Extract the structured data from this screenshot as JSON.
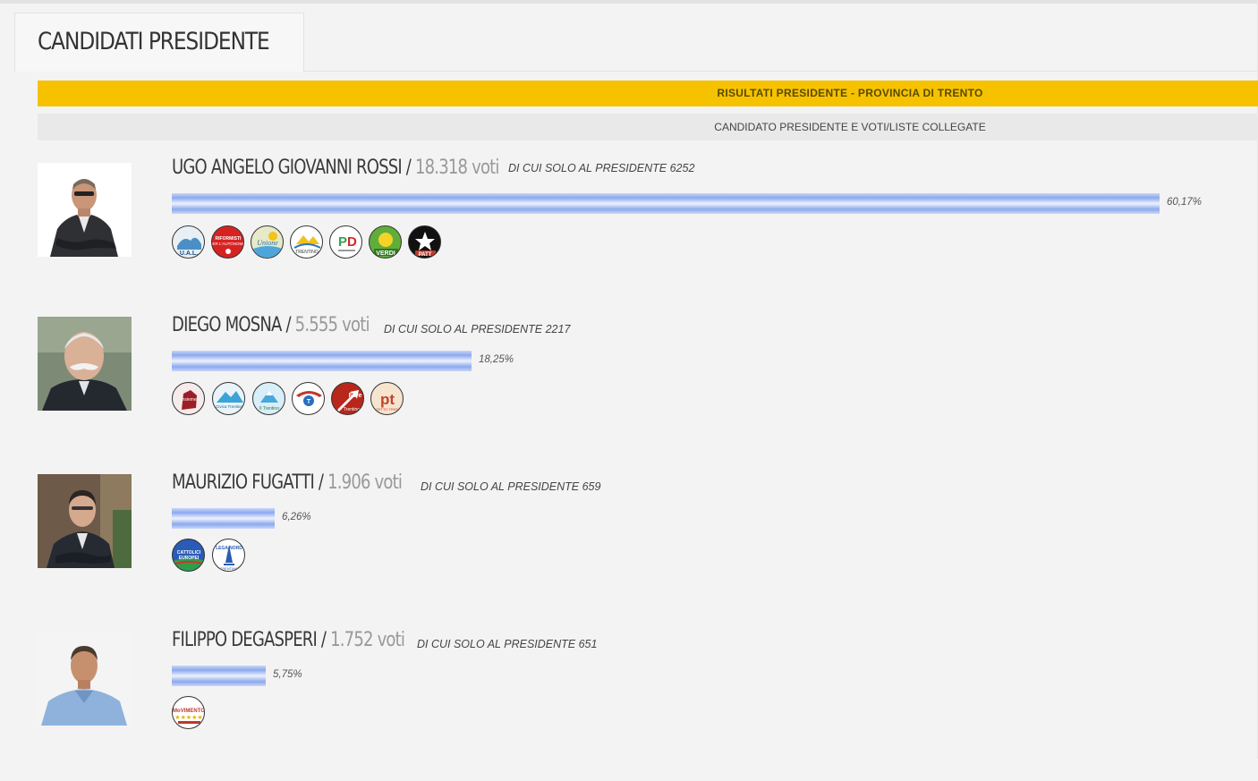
{
  "page": {
    "title": "CANDIDATI PRESIDENTE"
  },
  "results": {
    "header": "RISULTATI PRESIDENTE - PROVINCIA DI TRENTO",
    "subheader": "CANDIDATO PRESIDENTE E VOTI/LISTE COLLEGATE"
  },
  "candidates": [
    {
      "name": "UGO ANGELO GIOVANNI ROSSI",
      "separator": " / ",
      "votes": "18.318 voti",
      "solo": "DI CUI SOLO AL PRESIDENTE 6252",
      "percent": "60,17%",
      "share": 0.6017,
      "photo_icon": "candidate-photo-man-suit",
      "lists": [
        "UAL",
        "RIFORMISTI PER L'AUTONOMIA",
        "UNIONE DELL'ADIGE",
        "INTEGRALITÀ TRENTINO",
        "PD",
        "VERDI",
        "PATT"
      ]
    },
    {
      "name": "DIEGO MOSNA",
      "separator": " / ",
      "votes": "5.555 voti",
      "solo": "DI CUI SOLO AL PRESIDENTE 2217",
      "percent": "18,25%",
      "share": 0.1825,
      "photo_icon": "candidate-photo-man-mustache",
      "lists": [
        "Insieme per l'Autonomia",
        "Civica Trentina",
        "Il Trentino",
        "Amministrare il Trentino",
        "Fare Trentino",
        "Progetto Trentino"
      ]
    },
    {
      "name": "MAURIZIO FUGATTI",
      "separator": " / ",
      "votes": "1.906 voti",
      "solo": "DI CUI SOLO AL PRESIDENTE 659",
      "percent": "6,26%",
      "share": 0.0626,
      "photo_icon": "candidate-photo-man-dark-hair",
      "lists": [
        "Cattolici Europei Uniti",
        "Lega Nord Trentino"
      ]
    },
    {
      "name": "FILIPPO DEGASPERI",
      "separator": " / ",
      "votes": "1.752 voti",
      "solo": "DI CUI SOLO AL PRESIDENTE 651",
      "percent": "5,75%",
      "share": 0.0575,
      "photo_icon": "candidate-photo-man-blue-shirt",
      "lists": [
        "MoVimento 5 Stelle"
      ]
    }
  ],
  "colors": {
    "accent": "#f6c200",
    "bar": "#8ca9ee",
    "votes": "#999999"
  }
}
